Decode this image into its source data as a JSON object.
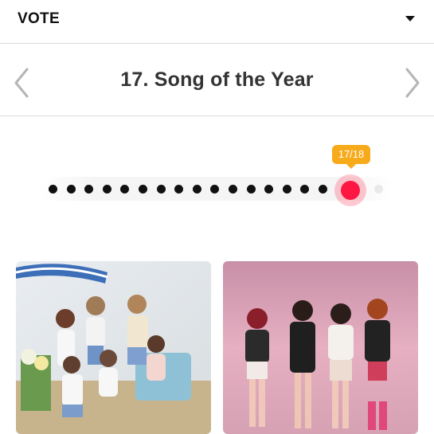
{
  "topbar": {
    "title": "VOTE",
    "dropdown_icon": "caret-down-icon"
  },
  "nav": {
    "heading": "17. Song of the Year",
    "prev_icon": "chevron-left-icon",
    "next_icon": "chevron-right-icon"
  },
  "progress": {
    "label": "17/18",
    "current": 17,
    "total": 18,
    "colors": {
      "done": "#111111",
      "current": "#ff1744",
      "pending": "#e9e9e9",
      "badge": "#f7ab1b"
    }
  },
  "nominees": [
    {
      "image": "group-photo-outdoor-pastel"
    },
    {
      "image": "group-photo-pink-studio"
    }
  ]
}
